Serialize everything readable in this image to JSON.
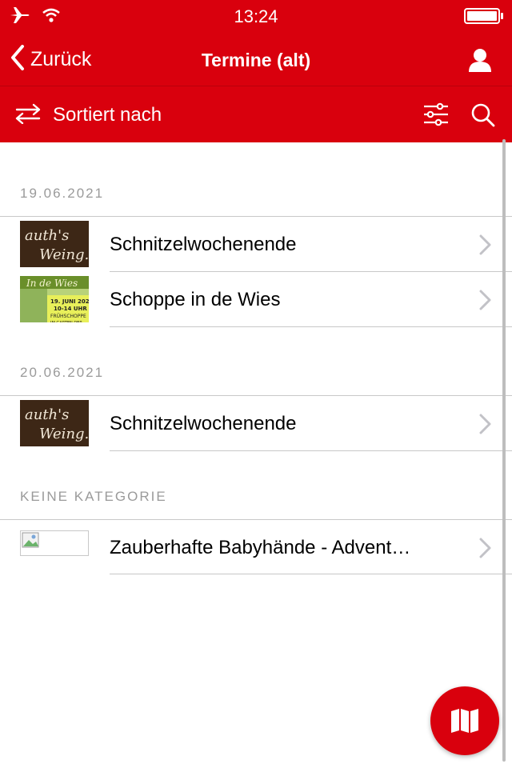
{
  "status_bar": {
    "time": "13:24",
    "icons": [
      "airplane-icon",
      "wifi-icon",
      "battery-icon"
    ]
  },
  "nav": {
    "back_label": "Zurück",
    "title": "Termine (alt)",
    "user_icon": "user-icon"
  },
  "toolbar": {
    "sort_label": "Sortiert nach",
    "icons": [
      "swap-arrows-icon",
      "filter-sliders-icon",
      "search-icon"
    ]
  },
  "sections": [
    {
      "header": "19.06.2021",
      "items": [
        {
          "title": "Schnitzelwochenende",
          "thumb": "logo-weingut"
        },
        {
          "title": "Schoppe in de Wies",
          "thumb": "poster-schoppe"
        }
      ]
    },
    {
      "header": "20.06.2021",
      "items": [
        {
          "title": "Schnitzelwochenende",
          "thumb": "logo-weingut"
        }
      ]
    },
    {
      "header": "KEINE KATEGORIE",
      "items": [
        {
          "title": "Zauberhafte Babyhände - Advent…",
          "thumb": "broken-image"
        }
      ]
    }
  ],
  "fab": {
    "icon": "map-icon"
  },
  "colors": {
    "brand_red": "#d9000d",
    "section_gray": "#9a9a9a",
    "divider": "#c8c8c8"
  }
}
